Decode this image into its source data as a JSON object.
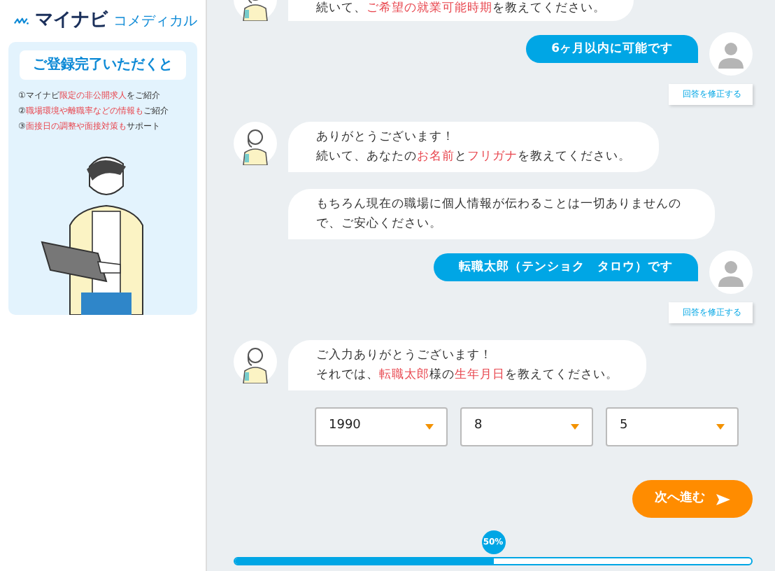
{
  "logo": {
    "brand": "マイナビ",
    "service": "コメディカル"
  },
  "sidebar": {
    "banner_title": "ご登録完了いただくと",
    "benefits": [
      [
        {
          "text": "①マイナビ",
          "highlight": false
        },
        {
          "text": "限定の非公開求人",
          "highlight": true
        },
        {
          "text": "をご紹介",
          "highlight": false
        }
      ],
      [
        {
          "text": "②",
          "highlight": false
        },
        {
          "text": "職場環境や離職率などの情報も",
          "highlight": true
        },
        {
          "text": "ご紹介",
          "highlight": false
        }
      ],
      [
        {
          "text": "③",
          "highlight": false
        },
        {
          "text": "面接日の調整や面接対策も",
          "highlight": true
        },
        {
          "text": "サポート",
          "highlight": false
        }
      ]
    ]
  },
  "messages": [
    {
      "kind": "bot_top",
      "lines": [
        [
          {
            "text": "続いて、",
            "highlight": false
          },
          {
            "text": "ご希望の就業可能時期",
            "highlight": true
          },
          {
            "text": "を教えてください。",
            "highlight": false
          }
        ]
      ]
    },
    {
      "kind": "user",
      "text": "6ヶ月以内に可能です",
      "edit_label": "回答を修正する"
    },
    {
      "kind": "bot",
      "lines": [
        [
          {
            "text": "ありがとうございます！",
            "highlight": false
          }
        ],
        [
          {
            "text": "続いて、あなたの",
            "highlight": false
          },
          {
            "text": "お名前",
            "highlight": true
          },
          {
            "text": "と",
            "highlight": false
          },
          {
            "text": "フリガナ",
            "highlight": true
          },
          {
            "text": "を教えてください。",
            "highlight": false
          }
        ]
      ]
    },
    {
      "kind": "plain",
      "lines": [
        [
          {
            "text": "もちろん現在の職場に個人情報が伝わることは一切ありませんので、ご安心ください。",
            "highlight": false
          }
        ]
      ]
    },
    {
      "kind": "user",
      "text": "転職太郎（テンショク　タロウ）です",
      "edit_label": "回答を修正する"
    },
    {
      "kind": "bot",
      "lines": [
        [
          {
            "text": "ご入力ありがとうございます！",
            "highlight": false
          }
        ],
        [
          {
            "text": "それでは、",
            "highlight": false
          },
          {
            "text": "転職太郎",
            "highlight": true
          },
          {
            "text": "様の",
            "highlight": false
          },
          {
            "text": "生年月日",
            "highlight": true
          },
          {
            "text": "を教えてください。",
            "highlight": false
          }
        ]
      ]
    }
  ],
  "birthdate_selects": [
    {
      "value": "1990"
    },
    {
      "value": "8"
    },
    {
      "value": "5"
    }
  ],
  "next_button": "次へ進む",
  "progress": {
    "level": 0.5,
    "label": "50%"
  }
}
